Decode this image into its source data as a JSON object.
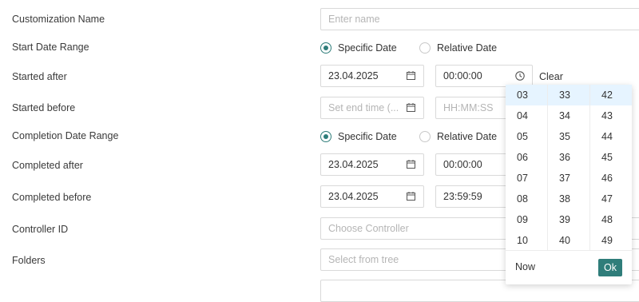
{
  "form": {
    "customization_name": {
      "label": "Customization Name",
      "placeholder": "Enter name"
    },
    "start_date_range": {
      "label": "Start Date Range",
      "option_specific": "Specific Date",
      "option_relative": "Relative Date"
    },
    "started_after": {
      "label": "Started after",
      "date": "23.04.2025",
      "time": "00:00:00",
      "clear": "Clear"
    },
    "started_before": {
      "label": "Started before",
      "date_placeholder": "Set end time (...",
      "time_placeholder": "HH:MM:SS"
    },
    "completion_date_range": {
      "label": "Completion Date Range",
      "option_specific": "Specific Date",
      "option_relative": "Relative Date"
    },
    "completed_after": {
      "label": "Completed after",
      "date": "23.04.2025",
      "time": "00:00:00"
    },
    "completed_before": {
      "label": "Completed before",
      "date": "23.04.2025",
      "time": "23:59:59"
    },
    "controller_id": {
      "label": "Controller ID",
      "placeholder": "Choose Controller"
    },
    "folders": {
      "label": "Folders",
      "placeholder": "Select from tree"
    }
  },
  "time_picker": {
    "hours": [
      "03",
      "04",
      "05",
      "06",
      "07",
      "08",
      "09",
      "10"
    ],
    "minutes": [
      "33",
      "34",
      "35",
      "36",
      "37",
      "38",
      "39",
      "40"
    ],
    "seconds": [
      "42",
      "43",
      "44",
      "45",
      "46",
      "47",
      "48",
      "49"
    ],
    "now_label": "Now",
    "ok_label": "Ok"
  },
  "colors": {
    "accent": "#2f7d7a",
    "selected_cell": "#e6f4ff"
  }
}
